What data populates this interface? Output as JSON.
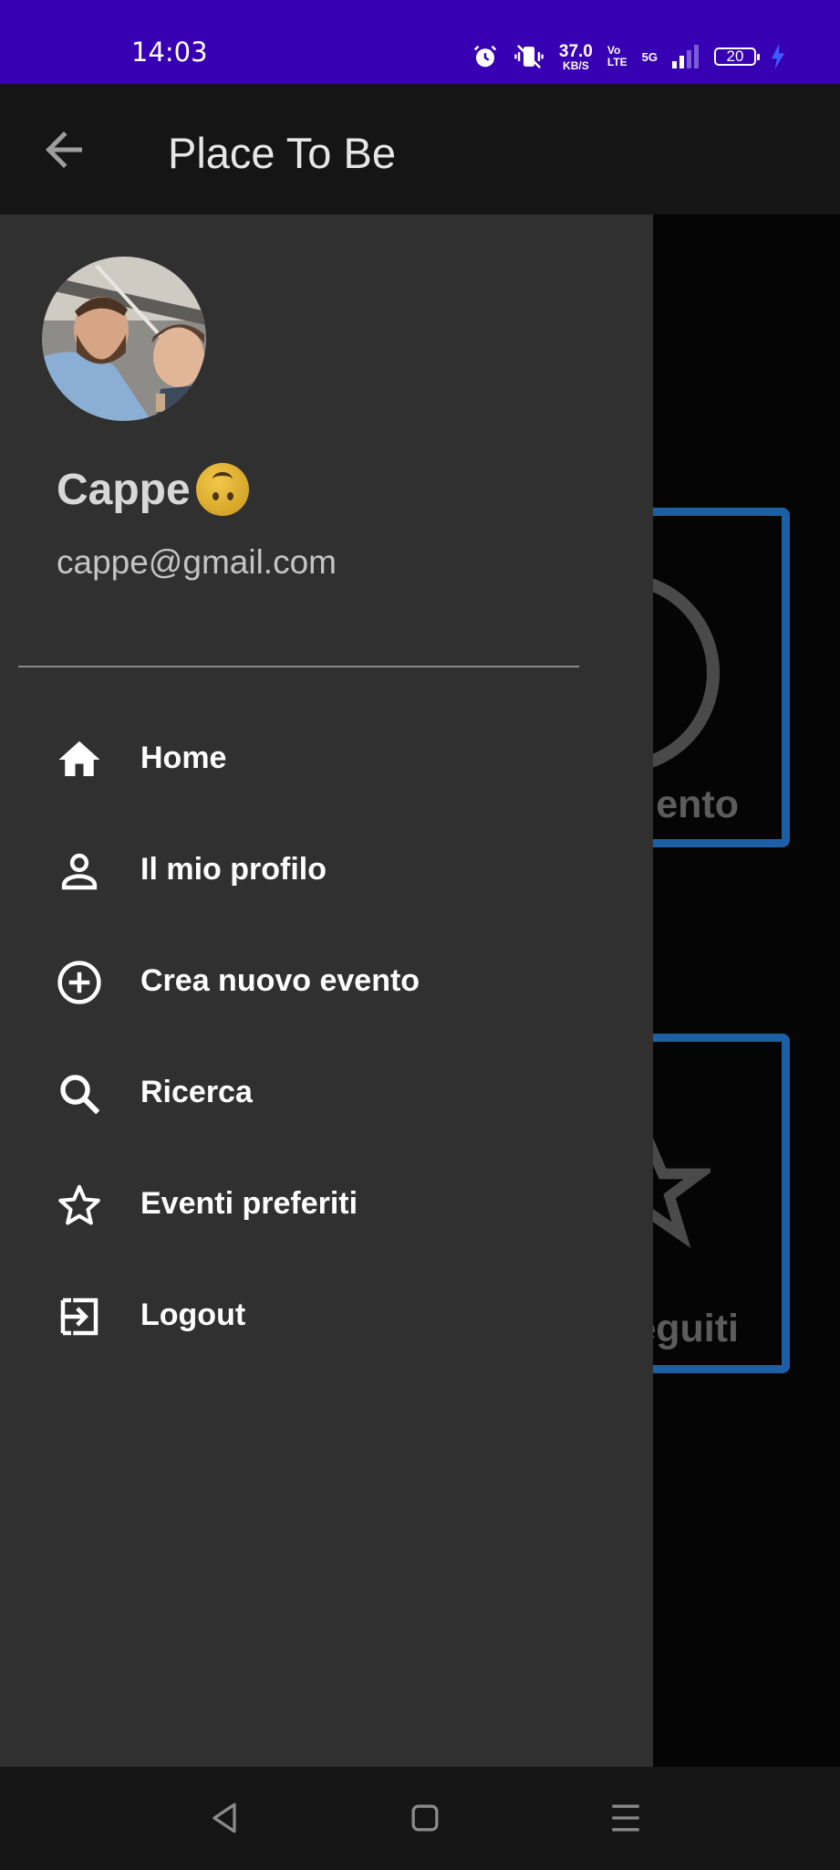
{
  "status_bar": {
    "time": "14:03",
    "net_speed_value": "37.0",
    "net_speed_unit": "KB/S",
    "volte_top": "Vo",
    "volte_bottom": "LTE",
    "network": "5G",
    "battery": "20",
    "icons": [
      "alarm-icon",
      "vibrate-icon",
      "signal-icon",
      "charging-icon"
    ]
  },
  "app_bar": {
    "title": "Place To Be",
    "back_icon": "arrow-left-icon"
  },
  "drawer": {
    "user_name": "Cappe",
    "user_email": "cappe@gmail.com",
    "menu": [
      {
        "label": "Home",
        "icon": "home-icon"
      },
      {
        "label": "Il mio profilo",
        "icon": "person-icon"
      },
      {
        "label": "Crea nuovo evento",
        "icon": "add-circle-icon"
      },
      {
        "label": "Ricerca",
        "icon": "search-icon"
      },
      {
        "label": "Eventi preferiti",
        "icon": "star-icon"
      },
      {
        "label": "Logout",
        "icon": "logout-icon"
      }
    ]
  },
  "background": {
    "card_1_label": "ento",
    "card_2_label": "eguiti"
  },
  "colors": {
    "status_bar": "#3700b3",
    "drawer": "#303030",
    "card_border": "#1c5fa5"
  }
}
